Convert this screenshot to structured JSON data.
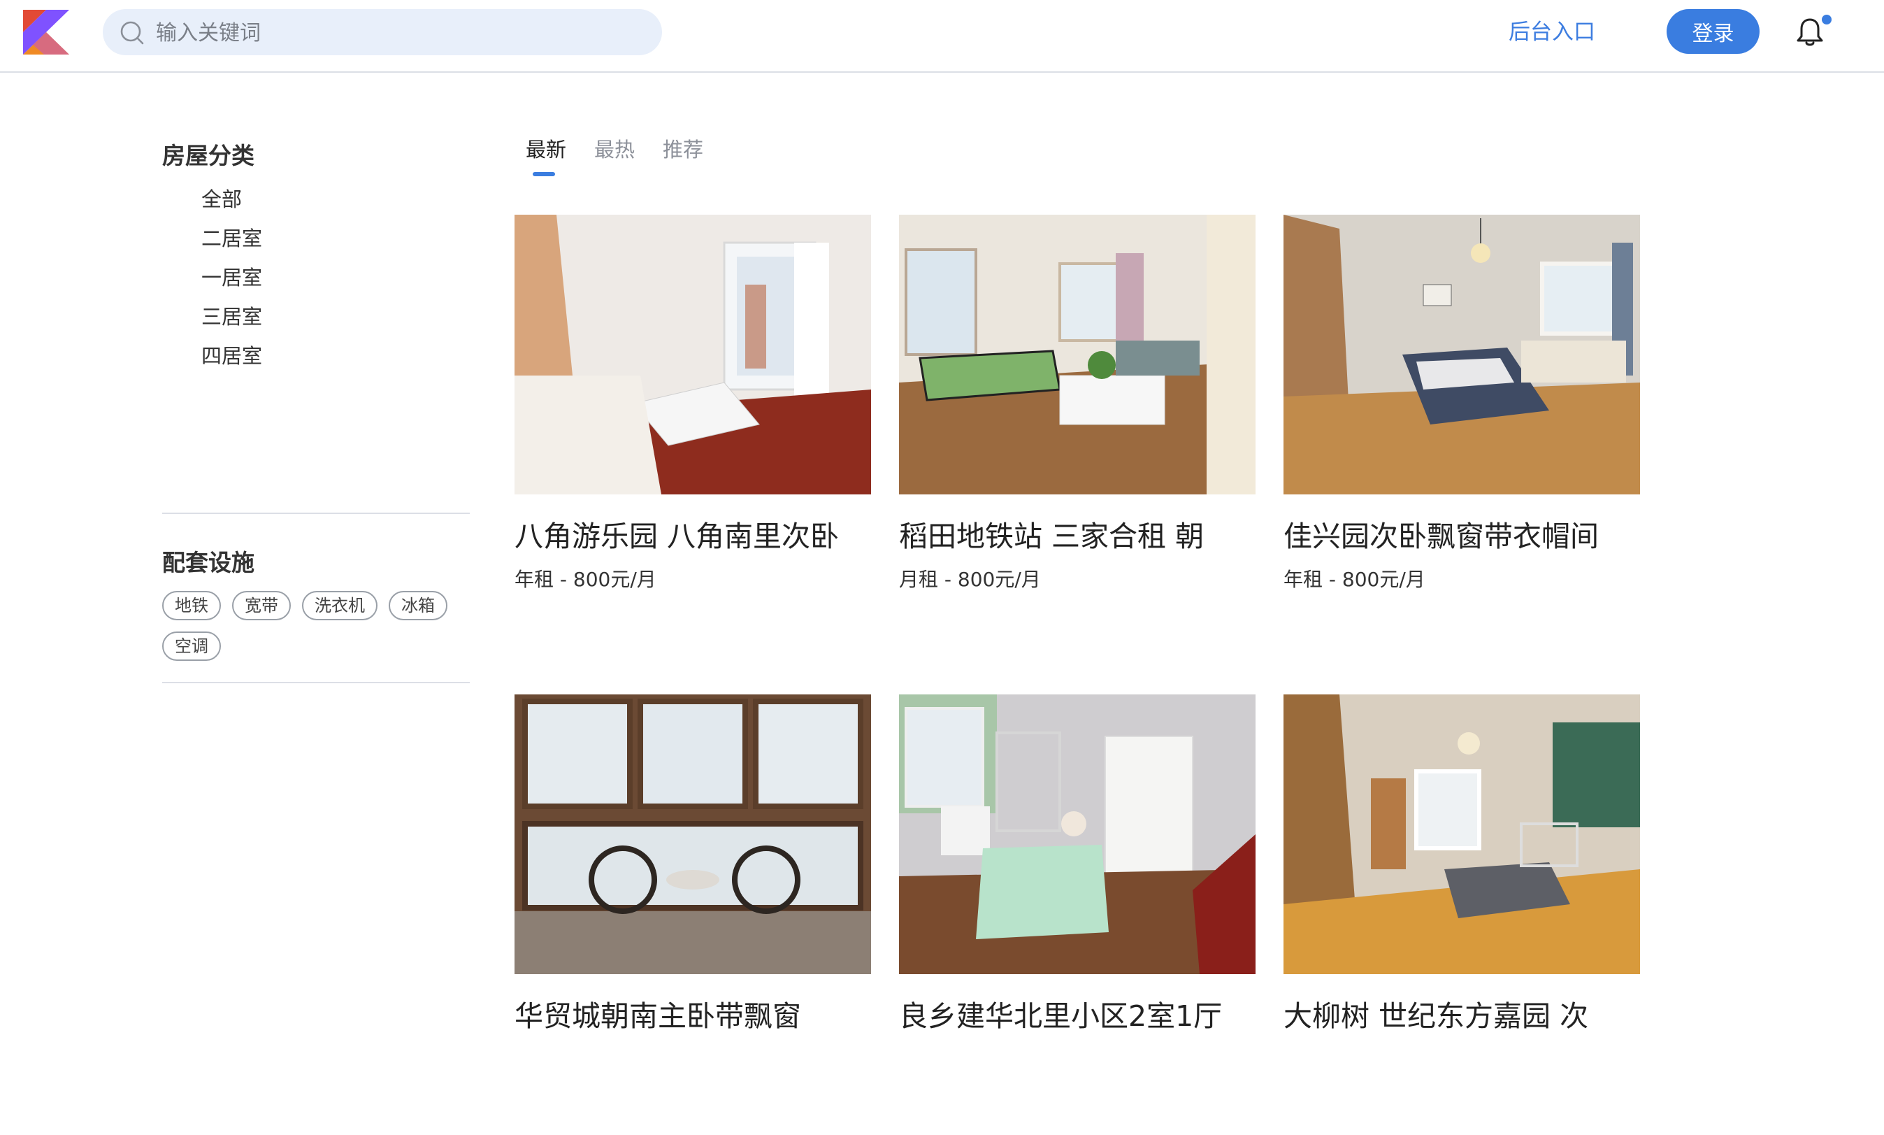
{
  "header": {
    "search_placeholder": "输入关键词",
    "admin_link": "后台入口",
    "login_label": "登录"
  },
  "sidebar": {
    "category_title": "房屋分类",
    "categories": [
      "全部",
      "二居室",
      "一居室",
      "三居室",
      "四居室"
    ],
    "facility_title": "配套设施",
    "facilities": [
      "地铁",
      "宽带",
      "洗衣机",
      "冰箱",
      "空调"
    ]
  },
  "tabs": [
    {
      "label": "最新",
      "active": true
    },
    {
      "label": "最热",
      "active": false
    },
    {
      "label": "推荐",
      "active": false
    }
  ],
  "listings": [
    {
      "title": "八角游乐园 八角南里次卧",
      "price": "年租 - 800元/月"
    },
    {
      "title": "稻田地铁站 三家合租 朝",
      "price": "月租 - 800元/月"
    },
    {
      "title": "佳兴园次卧飘窗带衣帽间",
      "price": "年租 - 800元/月"
    },
    {
      "title": "华贸城朝南主卧带飘窗",
      "price": ""
    },
    {
      "title": "良乡建华北里小区2室1厅",
      "price": ""
    },
    {
      "title": "大柳树 世纪东方嘉园 次",
      "price": ""
    }
  ],
  "colors": {
    "accent": "#3a7de0",
    "search_bg": "#e8effa",
    "divider": "#dcdfe6"
  }
}
